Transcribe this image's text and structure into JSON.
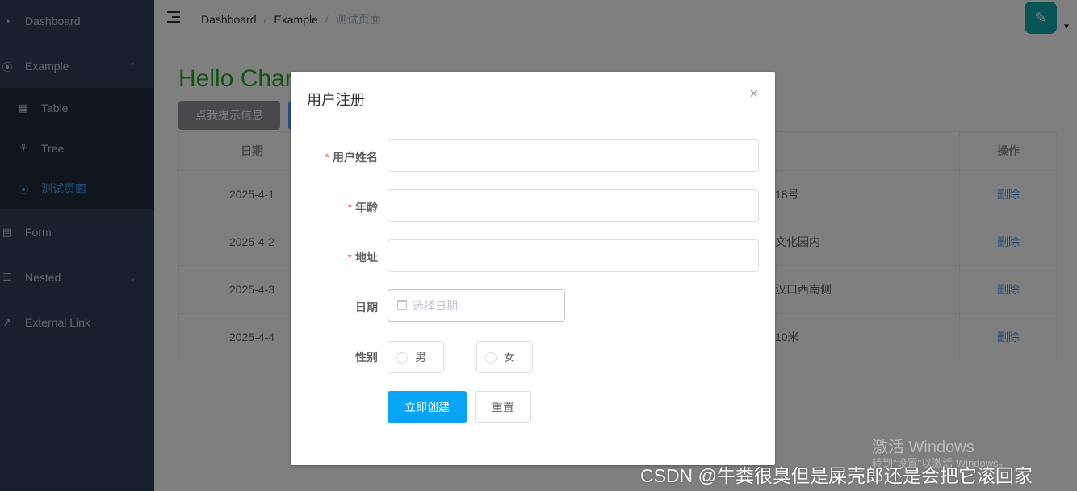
{
  "sidebar": {
    "items": [
      {
        "label": "Dashboard",
        "icon": "dashboard-icon"
      },
      {
        "label": "Example",
        "icon": "example-icon"
      },
      {
        "label": "Form",
        "icon": "form-icon"
      },
      {
        "label": "Nested",
        "icon": "nested-icon"
      },
      {
        "label": "External Link",
        "icon": "external-link-icon"
      }
    ],
    "submenu": [
      {
        "label": "Table",
        "icon": "table-icon"
      },
      {
        "label": "Tree",
        "icon": "tree-icon"
      },
      {
        "label": "测试页面",
        "icon": "test-page-icon",
        "active": true
      }
    ],
    "bg_color": "#304156",
    "active_color": "#409eff"
  },
  "navbar": {
    "breadcrumb": [
      "Dashboard",
      "Example",
      "测试页面"
    ],
    "separator": "/"
  },
  "main": {
    "hello_text": "Hello Char",
    "hint_button": "点我提示信息",
    "table": {
      "headers": {
        "date": "日期",
        "operation": "操作"
      },
      "rows": [
        {
          "date": "2025-4-1",
          "address_tail": "18号",
          "action": "删除"
        },
        {
          "date": "2025-4-2",
          "address_tail": "文化园内",
          "action": "删除"
        },
        {
          "date": "2025-4-3",
          "address_tail": "汉口西南侧",
          "action": "删除"
        },
        {
          "date": "2025-4-4",
          "address_tail": "10米",
          "action": "删除"
        }
      ]
    }
  },
  "dialog": {
    "title": "用户注册",
    "close": "×",
    "fields": {
      "name_label": "用户姓名",
      "age_label": "年龄",
      "address_label": "地址",
      "date_label": "日期",
      "date_placeholder": "选择日期",
      "gender_label": "性别",
      "gender_male": "男",
      "gender_female": "女",
      "required_mark": "*"
    },
    "submit": "立即创建",
    "reset": "重置",
    "primary_color": "#0aa4f6"
  },
  "watermarks": {
    "activate_title": "激活 Windows",
    "activate_sub": "转到\"设置\"以激活 Windows。",
    "csdn": "CSDN @牛粪很臭但是屎壳郎还是会把它滚回家"
  }
}
